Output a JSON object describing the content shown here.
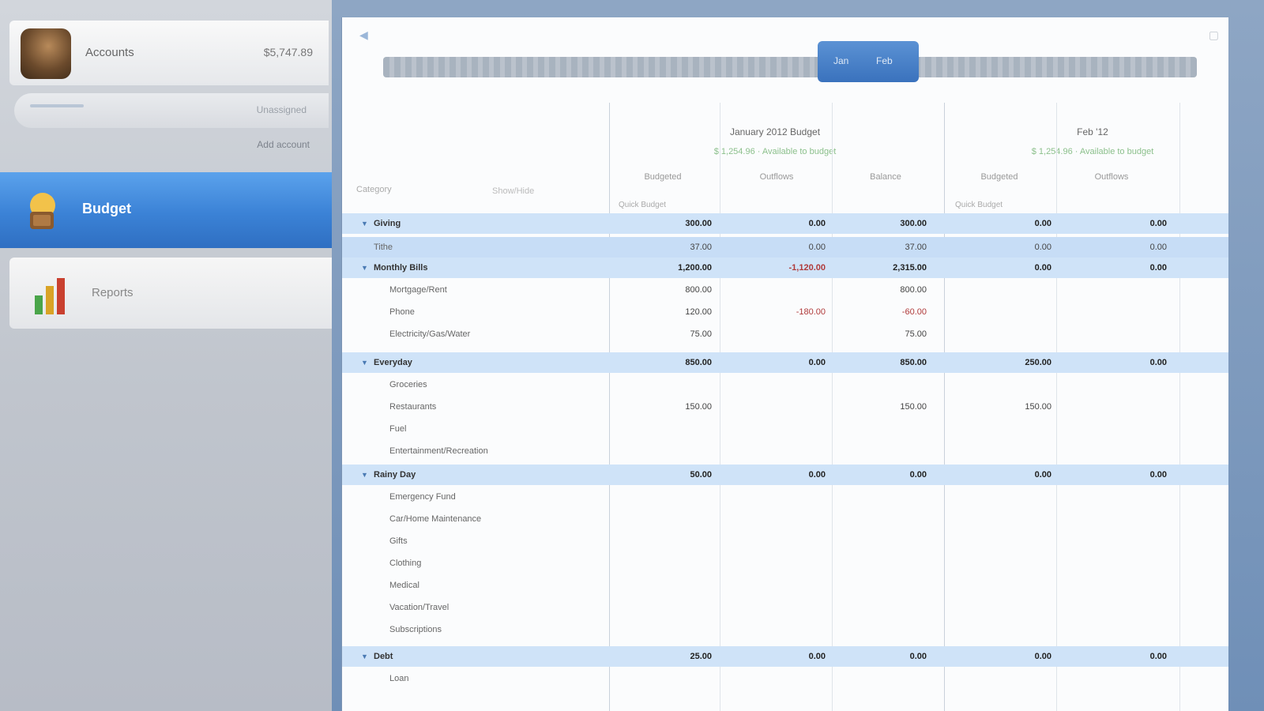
{
  "sidebar": {
    "account": {
      "name": "Accounts",
      "balance": "$5,747.89"
    },
    "sub": {
      "left": "",
      "right": "Unassigned",
      "link": "Add account"
    },
    "nav": [
      {
        "id": "budget",
        "label": "Budget",
        "icon": "wallet-icon"
      },
      {
        "id": "reports",
        "label": "Reports",
        "icon": "chart-icon"
      }
    ]
  },
  "main": {
    "months_selected": [
      "Jan",
      "Feb"
    ],
    "groups": [
      {
        "title": "January 2012 Budget",
        "sub": "$ 1,254.96 · Available to budget"
      },
      {
        "title": "Feb '12",
        "sub": "$ 1,254.96 · Available to budget"
      }
    ],
    "columns": {
      "left": [
        "Category",
        "Show/Hide"
      ],
      "g1": [
        "Budgeted",
        "Outflows",
        "Balance"
      ],
      "g2": [
        "Budgeted",
        "Outflows"
      ],
      "g1_sub": [
        "Quick Budget",
        "",
        ""
      ],
      "g2_sub": [
        "Quick Budget",
        ""
      ]
    },
    "rows": [
      {
        "label": "Giving",
        "type": "group",
        "values": [
          "300.00",
          "0.00",
          "300.00",
          "0.00",
          "0.00"
        ]
      },
      {
        "label": "Tithe",
        "type": "sel",
        "values": [
          "37.00",
          "0.00",
          "37.00",
          "0.00",
          "0.00"
        ]
      },
      {
        "label": "Monthly Bills",
        "type": "group",
        "values": [
          "1,200.00",
          "-1,120.00",
          "2,315.00",
          "0.00",
          "0.00"
        ]
      },
      {
        "label": "Mortgage/Rent",
        "type": "sub",
        "values": [
          "800.00",
          "",
          "800.00",
          "",
          ""
        ]
      },
      {
        "label": "Phone",
        "type": "sub",
        "values": [
          "120.00",
          "-180.00",
          "-60.00",
          "",
          ""
        ]
      },
      {
        "label": "Electricity/Gas/Water",
        "type": "sub",
        "values": [
          "75.00",
          "",
          "75.00",
          "",
          ""
        ]
      },
      {
        "label": "Everyday",
        "type": "group",
        "values": [
          "850.00",
          "0.00",
          "850.00",
          "250.00",
          "0.00"
        ]
      },
      {
        "label": "Groceries",
        "type": "sub",
        "values": [
          "",
          "",
          "",
          "",
          ""
        ]
      },
      {
        "label": "Restaurants",
        "type": "sub",
        "values": [
          "150.00",
          "",
          "150.00",
          "150.00",
          ""
        ]
      },
      {
        "label": "Fuel",
        "type": "sub",
        "values": [
          "",
          "",
          "",
          "",
          ""
        ]
      },
      {
        "label": "Entertainment/Recreation",
        "type": "sub",
        "values": [
          "",
          "",
          "",
          "",
          ""
        ]
      },
      {
        "label": "Rainy Day",
        "type": "group",
        "values": [
          "50.00",
          "0.00",
          "0.00",
          "0.00",
          "0.00"
        ]
      },
      {
        "label": "Emergency Fund",
        "type": "sub",
        "values": [
          "",
          "",
          "",
          "",
          ""
        ]
      },
      {
        "label": "Car/Home Maintenance",
        "type": "sub",
        "values": [
          "",
          "",
          "",
          "",
          ""
        ]
      },
      {
        "label": "Gifts",
        "type": "sub",
        "values": [
          "",
          "",
          "",
          "",
          ""
        ]
      },
      {
        "label": "Clothing",
        "type": "sub",
        "values": [
          "",
          "",
          "",
          "",
          ""
        ]
      },
      {
        "label": "Medical",
        "type": "sub",
        "values": [
          "",
          "",
          "",
          "",
          ""
        ]
      },
      {
        "label": "Vacation/Travel",
        "type": "sub",
        "values": [
          "",
          "",
          "",
          "",
          ""
        ]
      },
      {
        "label": "Subscriptions",
        "type": "sub",
        "values": [
          "",
          "",
          "",
          "",
          ""
        ]
      },
      {
        "label": "Debt",
        "type": "group",
        "values": [
          "25.00",
          "0.00",
          "0.00",
          "0.00",
          "0.00"
        ]
      },
      {
        "label": "Loan",
        "type": "sub",
        "values": [
          "",
          "",
          "",
          "",
          ""
        ]
      }
    ]
  }
}
